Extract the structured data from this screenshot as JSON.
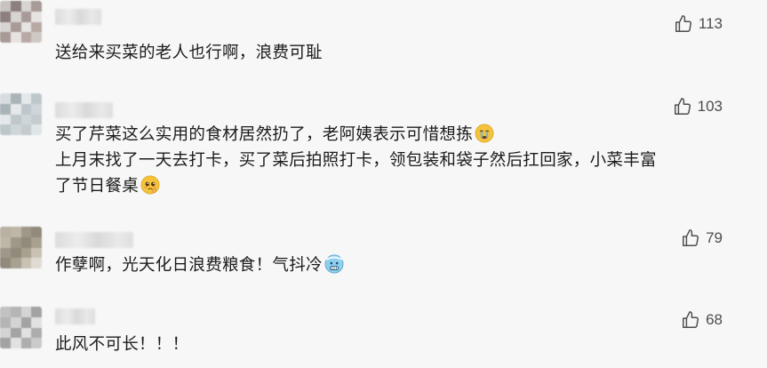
{
  "comments": [
    {
      "likes": "113",
      "lines": [
        "送给来买菜的老人也行啊，浪费可耻"
      ],
      "emoji_after_line": [
        null
      ]
    },
    {
      "likes": "103",
      "lines": [
        "买了芹菜这么实用的食材居然扔了，老阿姨表示可惜想拣",
        "上月末找了一天去打卡，买了菜后拍照打卡，领包装和袋子然后扛回家，小菜丰富",
        "了节日餐桌"
      ],
      "emoji_after_line": [
        "crying-face",
        null,
        "pleading-face"
      ]
    },
    {
      "likes": "79",
      "lines": [
        "作孽啊，光天化日浪费粮食！气抖冷"
      ],
      "emoji_after_line": [
        "cold-face"
      ]
    },
    {
      "likes": "68",
      "lines": [
        "此风不可长！！！"
      ],
      "emoji_after_line": [
        null
      ]
    }
  ],
  "colors": {
    "background": "#f7f7f7",
    "text": "#1b1b1b",
    "like_count": "#4d4d4d",
    "avatar_palettes": [
      [
        "#c9c4c0",
        "#b9a9a4",
        "#d8d4d2",
        "#9e8f8c",
        "#e6e3e1",
        "#8c7f7e",
        "#cfc9c6",
        "#a89a96"
      ],
      [
        "#d7dde0",
        "#c4ccd0",
        "#e4e8ea",
        "#b8c1c6",
        "#cfd6d9",
        "#a9b3b8",
        "#e0e5e7",
        "#bec7cb"
      ],
      [
        "#b8b1a4",
        "#c9c2b4",
        "#9f9789",
        "#d6d0c4",
        "#a8a18f",
        "#bfb7a6",
        "#e0dbd2",
        "#928a7b"
      ],
      [
        "#c2c2c2",
        "#adadad",
        "#d4d4d4",
        "#999999",
        "#e1e1e1",
        "#b5b5b5",
        "#cacaca",
        "#a3a3a3"
      ]
    ]
  }
}
